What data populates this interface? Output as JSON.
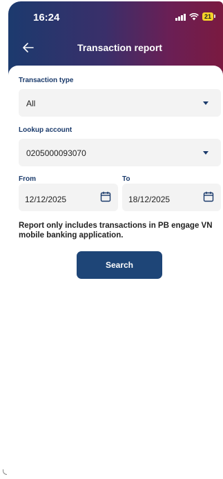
{
  "status_bar": {
    "time": "16:24",
    "battery": "21",
    "battery_color": "#f5d328"
  },
  "nav": {
    "title": "Transaction report",
    "back_icon": "arrow-left-icon"
  },
  "form": {
    "transaction_type": {
      "label": "Transaction type",
      "value": "All"
    },
    "lookup_account": {
      "label": "Lookup account",
      "value": "0205000093070"
    },
    "from": {
      "label": "From",
      "value": "12/12/2025",
      "icon": "calendar-icon"
    },
    "to": {
      "label": "To",
      "value": "18/12/2025",
      "icon": "calendar-icon"
    }
  },
  "note": "Report only includes transactions in PB engage VN mobile banking application.",
  "search_button": {
    "label": "Search",
    "color": "#1e4577"
  },
  "colors": {
    "header_gradient_start": "#1c3a6e",
    "header_gradient_end": "#7a1a40",
    "label_color": "#1a3a6b",
    "field_bg": "#f3f3f3"
  }
}
